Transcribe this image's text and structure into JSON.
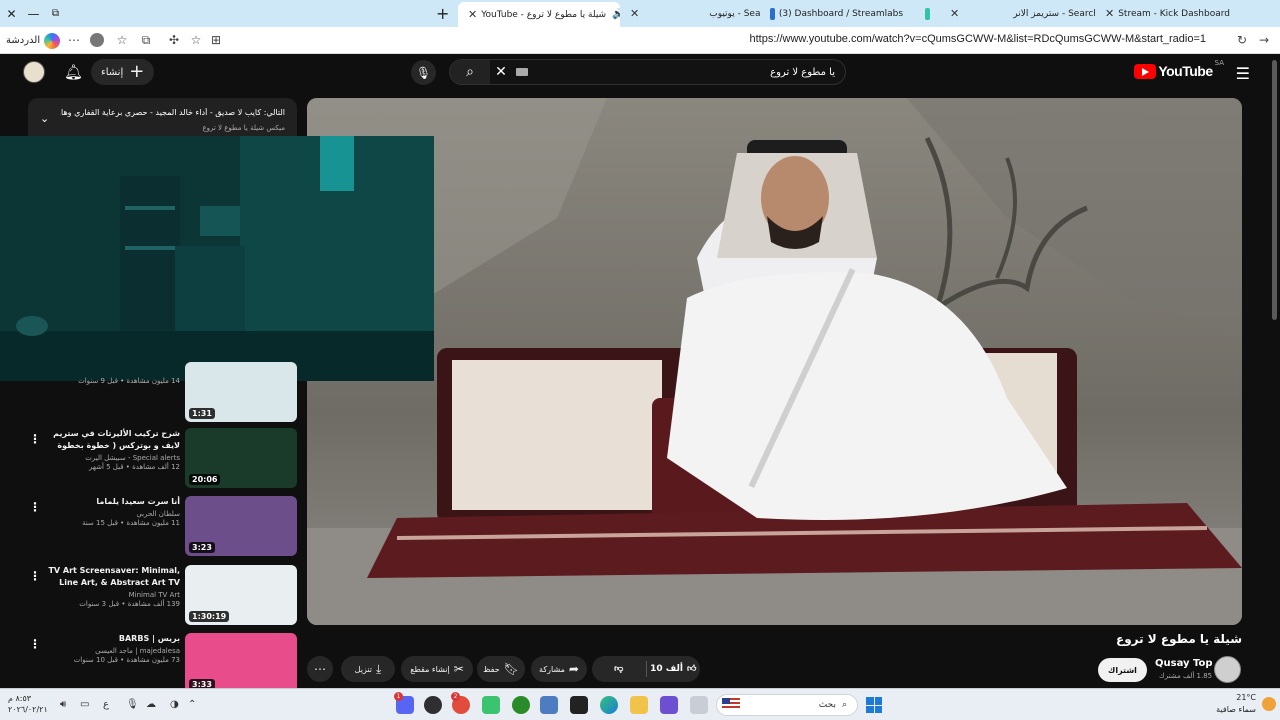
{
  "browser": {
    "tabs": [
      {
        "title": "YouTube - شيلة يا مطوع لا تروع",
        "active": true
      },
      {
        "title": "يوتيوب - Search",
        "active": false
      },
      {
        "title": "(3) Dashboard / Streamlabs",
        "active": false
      },
      {
        "title": "ستريمز الانر - Search",
        "active": false
      },
      {
        "title": "Stream - Kick Dashboard",
        "active": false
      }
    ],
    "url": "https://www.youtube.com/watch?v=cQumsGCWW-M&list=RDcQumsGCWW-M&start_radio=1",
    "copilot_label": "الدردشة"
  },
  "youtube": {
    "create_label": "إنشاء",
    "search_query": "يا مطوع لا تروع",
    "logo_text": "YouTube",
    "region": "SA"
  },
  "playlist": {
    "next_label": "التالي: كايب لا صديق - أداء خالد المجيد - حصري برعاية القفاري وها...",
    "mix_label": "ميكس شيلة يا مطوع لا تروع"
  },
  "recommendations": [
    {
      "title": "",
      "channel": "",
      "stats": "14 مليون مشاهدة • قبل 9 سنوات",
      "duration": "1:31",
      "thumb_color": "#d9e6ea"
    },
    {
      "title": "شرح تركيب الأليرتات في ستريم لايف و بوتركس ( خطوة بخطوة 👌 )",
      "channel": "Special alerts - سبيشل اليرت",
      "stats": "12 ألف مشاهدة • قبل 5 أشهر",
      "duration": "20:06",
      "thumb_color": "#1b3b2a"
    },
    {
      "title": "أنا سرت سعيدا يلماما",
      "channel": "سلطان الحربي",
      "stats": "11 مليون مشاهدة • قبل 15 سنة",
      "duration": "3:23",
      "thumb_color": "#6b4e8a"
    },
    {
      "title": "TV Art Screensaver: Minimal, Line Art, & Abstract Art TV ...",
      "channel": "Minimal TV Art",
      "stats": "139 ألف مشاهدة • قبل 3 سنوات",
      "duration": "1:30:19",
      "thumb_color": "#e9eef0"
    },
    {
      "title": "بريس | BARBS",
      "channel": "majedalesa | ماجد العيسى",
      "stats": "73 مليون مشاهدة • قبل 10 سنوات",
      "duration": "3:33",
      "thumb_color": "#e84c8a"
    }
  ],
  "video": {
    "title": "شيلة يا مطوع لا تروع",
    "likes": "10 ألف",
    "share_label": "مشاركة",
    "save_label": "حفظ",
    "clip_label": "إنشاء مقطع",
    "download_label": "تنزيل",
    "subscribe_label": "اشتراك",
    "channel_name": "Qusay Top",
    "channel_subs": "1.85 ألف مشترك"
  },
  "taskbar": {
    "search_placeholder": "بحث",
    "weather_temp": "21°C",
    "weather_desc": "سماء صافية",
    "clock_time": "٨:٥٣ م",
    "clock_date": "٢٠٢٦/٠٢/٢١",
    "lang": "ع",
    "badges": [
      "1",
      "2"
    ]
  },
  "colors": {
    "yt_bg": "#0f0f0f",
    "yt_red": "#ff0000",
    "pill_bg": "#272727",
    "tabstrip_bg": "#cfe8f7",
    "cam_teal": "#0b3a3a"
  }
}
